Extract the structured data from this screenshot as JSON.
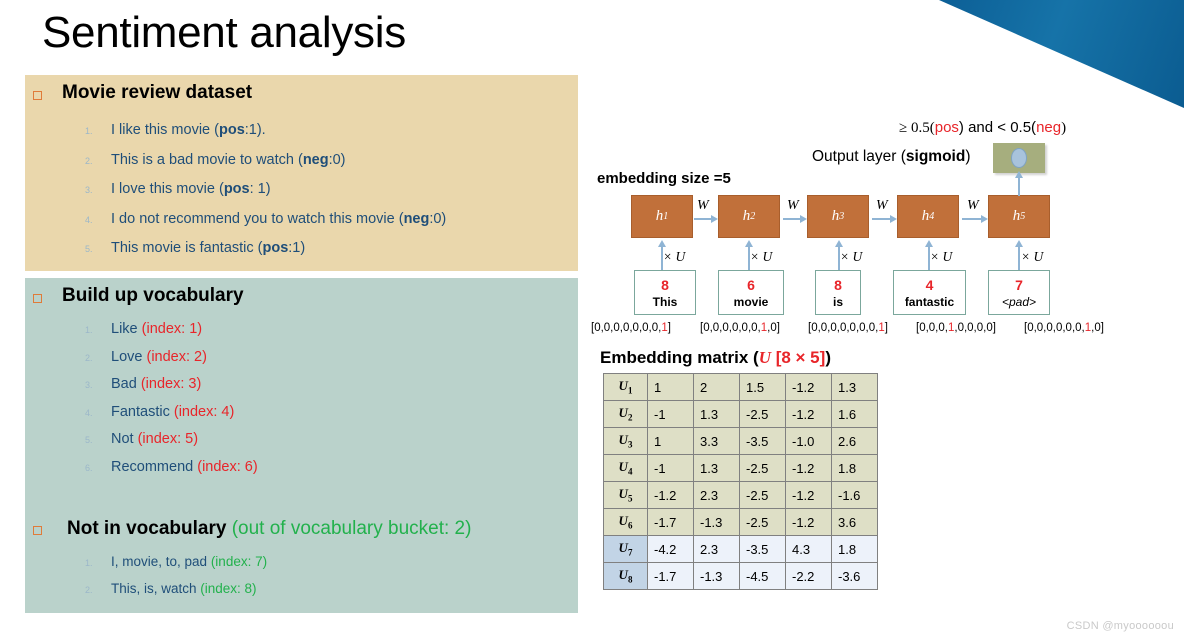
{
  "slide": {
    "title": "Sentiment analysis",
    "watermark": "CSDN @myoooooou"
  },
  "dataset_panel": {
    "heading": "Movie review dataset",
    "bg_color": "#EAD7AC",
    "items": [
      {
        "n": "1.",
        "pre": "I like this movie (",
        "bold": "pos",
        "post": ":1)."
      },
      {
        "n": "2.",
        "pre": "This is a bad movie to watch (",
        "bold": "neg",
        "post": ":0)"
      },
      {
        "n": "3.",
        "pre": "I love this movie (",
        "bold": "pos",
        "post": ": 1)"
      },
      {
        "n": "4.",
        "pre": "I do not recommend you to watch this movie (",
        "bold": "neg",
        "post": ":0)"
      },
      {
        "n": "5.",
        "pre": "This movie is fantastic (",
        "bold": "pos",
        "post": ":1)"
      }
    ]
  },
  "vocab_panel": {
    "heading": "Build up vocabulary",
    "bg_color": "#BAD2CB",
    "items": [
      {
        "n": "1.",
        "word": "Like ",
        "index": "(index: 1)"
      },
      {
        "n": "2.",
        "word": "Love ",
        "index": "(index: 2)"
      },
      {
        "n": "3.",
        "word": "Bad ",
        "index": "(index: 3)"
      },
      {
        "n": "4.",
        "word": "Fantastic ",
        "index": "(index: 4)"
      },
      {
        "n": "5.",
        "word": "Not ",
        "index": "(index: 5)"
      },
      {
        "n": "6.",
        "word": "Recommend ",
        "index": "(index: 6)"
      }
    ],
    "oov_heading": "Not in vocabulary ",
    "oov_note": "(out of vocabulary bucket: 2)",
    "oov_items": [
      {
        "n": "1.",
        "word": "I, movie, to, pad ",
        "index": "(index: 7)"
      },
      {
        "n": "2.",
        "word": "This, is, watch ",
        "index": "(index: 8)"
      }
    ]
  },
  "network": {
    "threshold_prefix": "≥ 0.5(",
    "threshold_pos": "pos",
    "threshold_mid": ") and < 0.5(",
    "threshold_neg": "neg",
    "threshold_suffix": ")",
    "output_layer_label": "Output layer (sigmoid)",
    "output_layer_label_plain": "Output layer (",
    "output_layer_label_bold": "sigmoid",
    "output_layer_label_end": ")",
    "embedding_size_label": "embedding size =5",
    "hidden_units": [
      "h",
      "h",
      "h",
      "h",
      "h"
    ],
    "hidden_subs": [
      "1",
      "2",
      "3",
      "4",
      "5"
    ],
    "w_labels": [
      "W",
      "W",
      "W",
      "W"
    ],
    "u_labels": [
      "× U",
      "× U",
      "× U",
      "× U",
      "× U"
    ],
    "tokens": [
      {
        "num": "8",
        "word": "This",
        "pad": false,
        "onehot_pre": "[0,0,0,0,0,0,0,",
        "onehot_hot": "1",
        "onehot_post": "]"
      },
      {
        "num": "6",
        "word": "movie",
        "pad": false,
        "onehot_pre": "[0,0,0,0,0,0,",
        "onehot_hot": "1",
        "onehot_post": ",0]"
      },
      {
        "num": "8",
        "word": "is",
        "pad": false,
        "onehot_pre": "[0,0,0,0,0,0,0,",
        "onehot_hot": "1",
        "onehot_post": "]"
      },
      {
        "num": "4",
        "word": "fantastic",
        "pad": false,
        "onehot_pre": "[0,0,0,",
        "onehot_hot": "1",
        "onehot_post": ",0,0,0,0]"
      },
      {
        "num": "7",
        "word": "<pad>",
        "pad": true,
        "onehot_pre": "[0,0,0,0,0,0,",
        "onehot_hot": "1",
        "onehot_post": ",0]"
      }
    ]
  },
  "embedding_matrix": {
    "title_prefix": "Embedding matrix (",
    "title_u": "U",
    "title_dims": " [8 × 5]",
    "title_suffix": ")",
    "rows": [
      {
        "label": "U",
        "sub": "1",
        "band": "green",
        "values": [
          "1",
          "2",
          "1.5",
          "-1.2",
          "1.3"
        ]
      },
      {
        "label": "U",
        "sub": "2",
        "band": "green",
        "values": [
          "-1",
          "1.3",
          "-2.5",
          "-1.2",
          "1.6"
        ]
      },
      {
        "label": "U",
        "sub": "3",
        "band": "green",
        "values": [
          "1",
          "3.3",
          "-3.5",
          "-1.0",
          "2.6"
        ]
      },
      {
        "label": "U",
        "sub": "4",
        "band": "green",
        "values": [
          "-1",
          "1.3",
          "-2.5",
          "-1.2",
          "1.8"
        ]
      },
      {
        "label": "U",
        "sub": "5",
        "band": "green",
        "values": [
          "-1.2",
          "2.3",
          "-2.5",
          "-1.2",
          "-1.6"
        ]
      },
      {
        "label": "U",
        "sub": "6",
        "band": "green",
        "values": [
          "-1.7",
          "-1.3",
          "-2.5",
          "-1.2",
          "3.6"
        ]
      },
      {
        "label": "U",
        "sub": "7",
        "band": "blue",
        "values": [
          "-4.2",
          "2.3",
          "-3.5",
          "4.3",
          "1.8"
        ]
      },
      {
        "label": "U",
        "sub": "8",
        "band": "blue",
        "values": [
          "-1.7",
          "-1.3",
          "-4.5",
          "-2.2",
          "-3.6"
        ]
      }
    ]
  },
  "colors": {
    "accent_red": "#E8252A",
    "accent_green": "#22B14C",
    "hidden_box": "#C1703A",
    "output_box": "#A6AE7E",
    "triangle_blue": "#0c5f96"
  }
}
